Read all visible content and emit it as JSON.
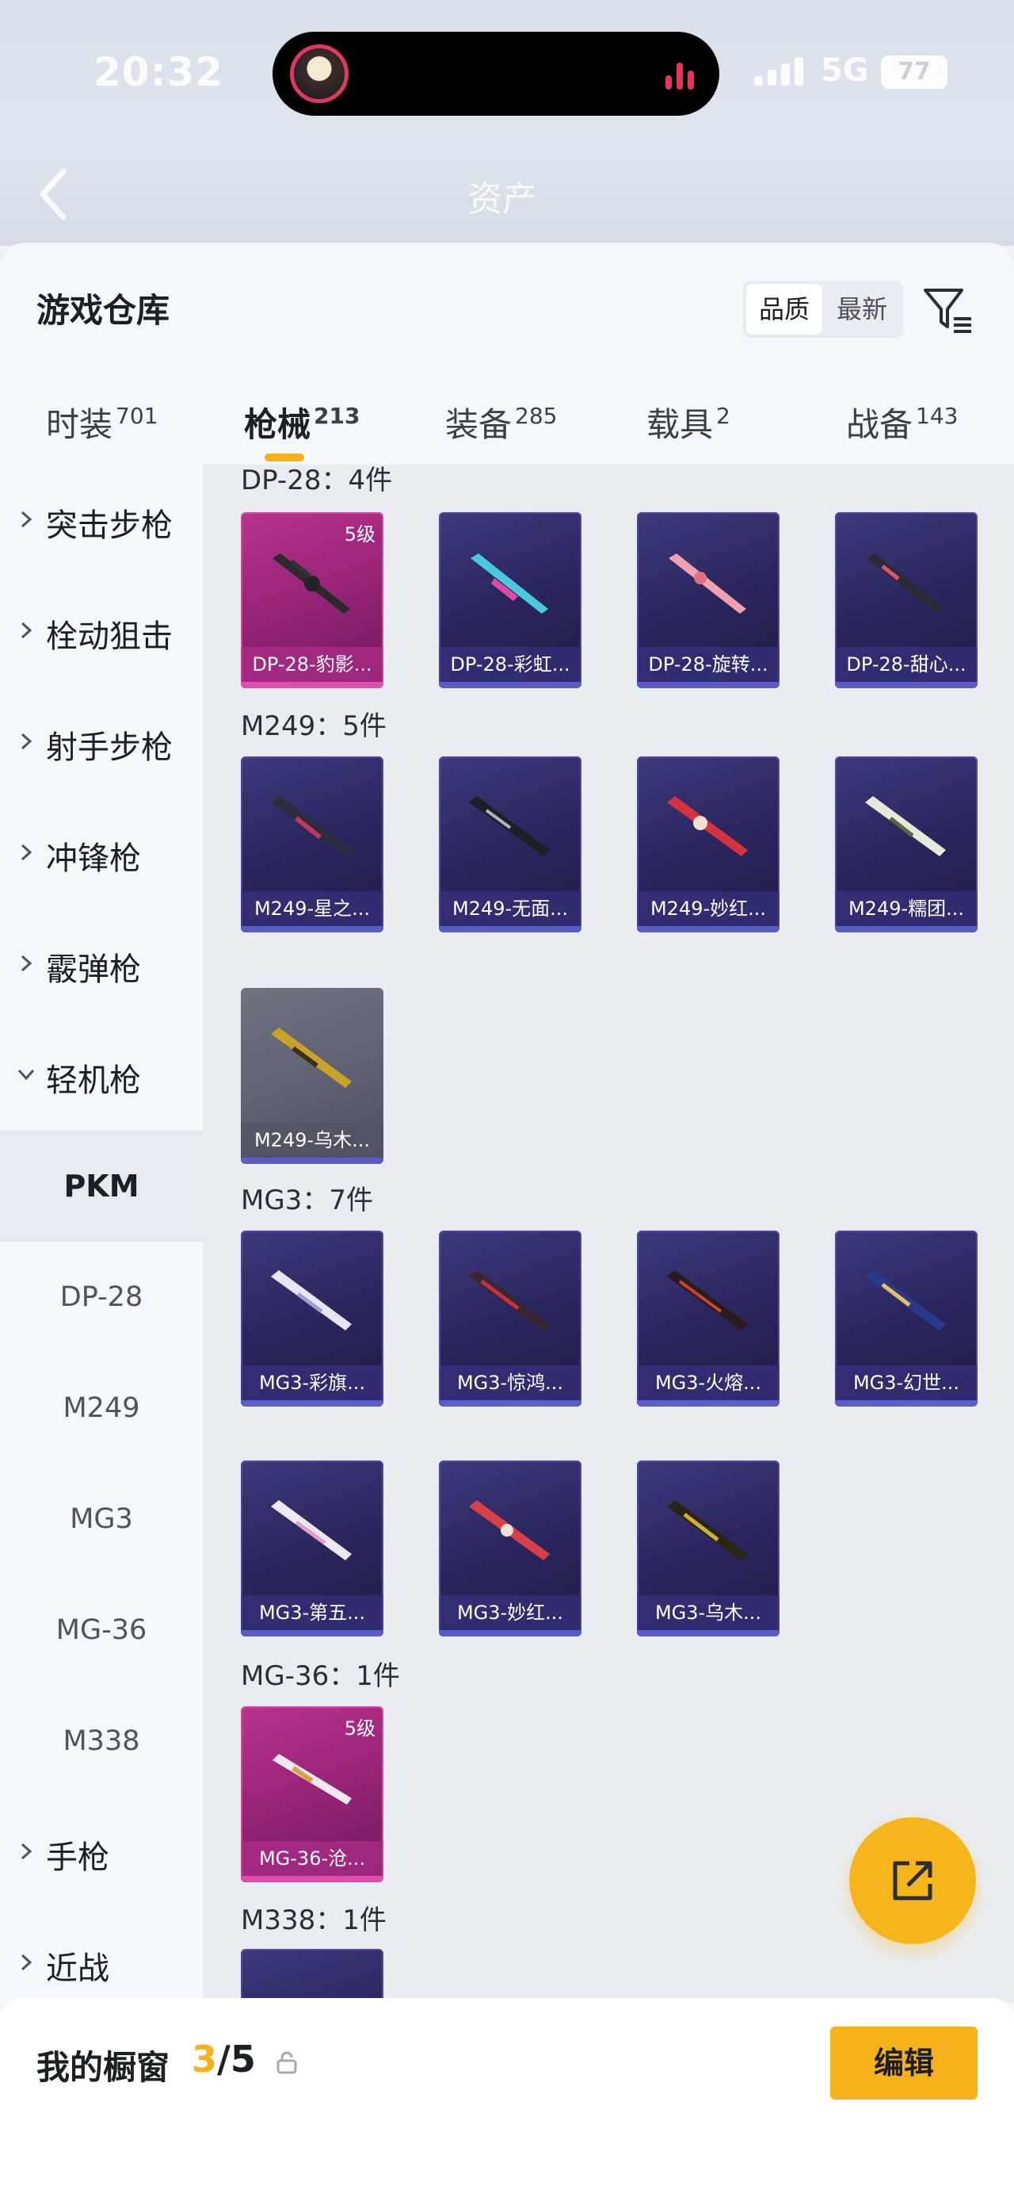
{
  "status_bar": {
    "time": "20:32",
    "network": "5G",
    "battery": "77"
  },
  "header": {
    "back_icon": "chevron-left-icon",
    "title": "资产"
  },
  "sheet": {
    "title": "游戏仓库",
    "sort": {
      "options": [
        "品质",
        "最新"
      ],
      "active": "品质"
    },
    "filter_icon": "filter-icon"
  },
  "tabs": [
    {
      "label": "时装",
      "count": "701",
      "active": false
    },
    {
      "label": "枪械",
      "count": "213",
      "active": true
    },
    {
      "label": "装备",
      "count": "285",
      "active": false
    },
    {
      "label": "载具",
      "count": "2",
      "active": false
    },
    {
      "label": "战备",
      "count": "143",
      "active": false
    }
  ],
  "sidebar": {
    "categories": [
      "突击步枪",
      "栓动狙击",
      "射手步枪",
      "冲锋枪",
      "霰弹枪",
      "轻机枪"
    ],
    "subcategories": [
      "PKM",
      "DP-28",
      "M249",
      "MG3",
      "MG-36",
      "M338"
    ],
    "active_sub": "PKM",
    "more_categories": [
      "手枪",
      "近战"
    ]
  },
  "groups": [
    {
      "title": "DP-28：4件",
      "items": [
        "DP-28-豹影...",
        "DP-28-彩虹...",
        "DP-28-旋转...",
        "DP-28-甜心..."
      ]
    },
    {
      "title": "M249：5件",
      "items": [
        "M249-星之...",
        "M249-无面...",
        "M249-妙红...",
        "M249-糯团...",
        "M249-乌木..."
      ]
    },
    {
      "title": "MG3：7件",
      "items": [
        "MG3-彩旗...",
        "MG3-惊鸿...",
        "MG3-火熔...",
        "MG3-幻世...",
        "MG3-第五...",
        "MG3-妙红...",
        "MG3-乌木..."
      ]
    },
    {
      "title": "MG-36：1件",
      "items": [
        "MG-36-沧..."
      ]
    },
    {
      "title": "M338：1件",
      "items": []
    }
  ],
  "level_badge": "5级",
  "fab_icon": "share-external-icon",
  "bottom": {
    "title": "我的橱窗",
    "count_current": "3",
    "count_total": "/5",
    "lock_icon": "lock-icon",
    "edit_label": "编辑"
  }
}
